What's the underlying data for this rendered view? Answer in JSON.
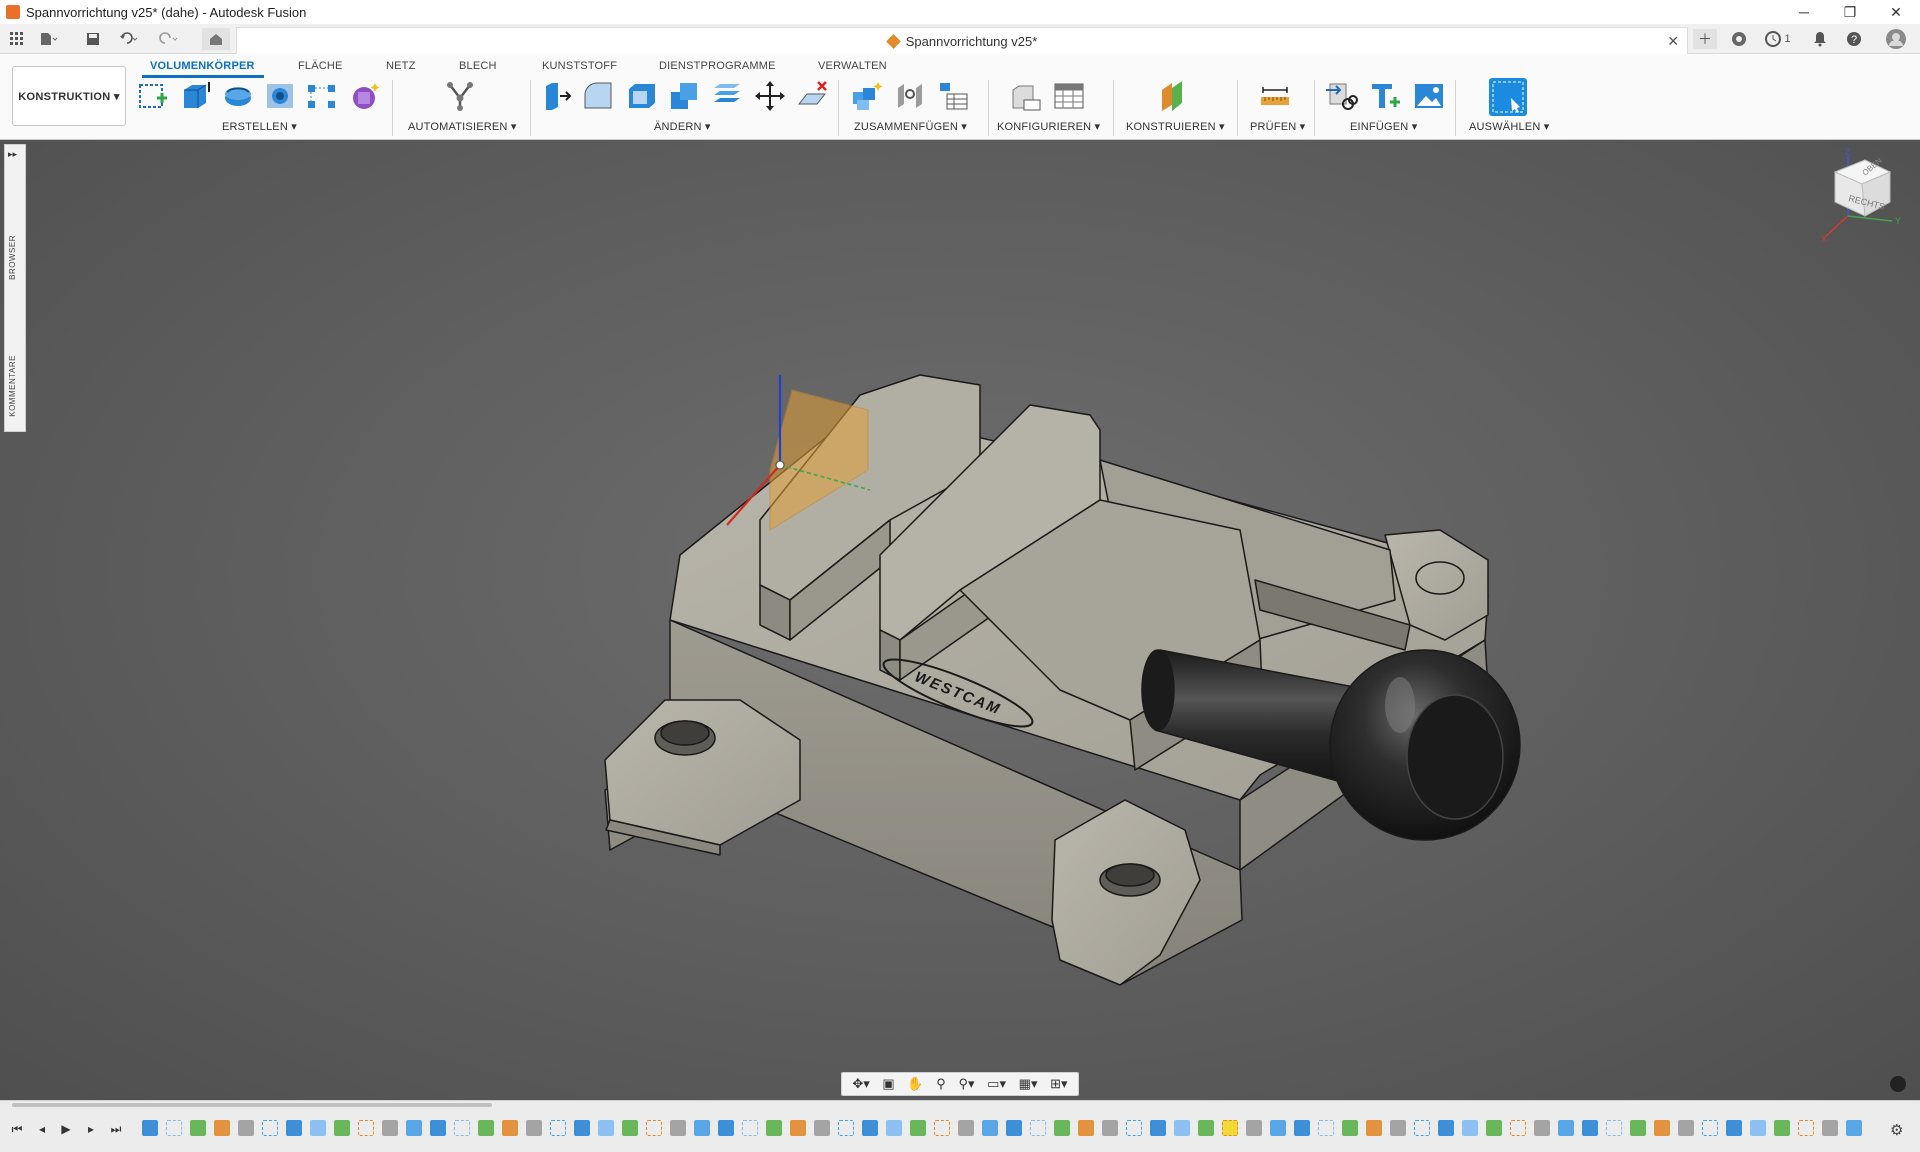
{
  "window": {
    "title": "Spannvorrichtung v25* (dahe) - Autodesk Fusion",
    "minimize": "─",
    "restore": "❐",
    "close": "✕"
  },
  "document_tab": {
    "title": "Spannvorrichtung v25*",
    "close": "✕",
    "job_count": "1"
  },
  "workspace": {
    "label": "KONSTRUKTION ▾"
  },
  "tabs": [
    {
      "label": "VOLUMENKÖRPER",
      "active": true
    },
    {
      "label": "FLÄCHE"
    },
    {
      "label": "NETZ"
    },
    {
      "label": "BLECH"
    },
    {
      "label": "KUNSTSTOFF"
    },
    {
      "label": "DIENSTPROGRAMME"
    },
    {
      "label": "VERWALTEN"
    }
  ],
  "groups": [
    {
      "label": "ERSTELLEN ▾"
    },
    {
      "label": "AUTOMATISIEREN ▾"
    },
    {
      "label": "ÄNDERN ▾"
    },
    {
      "label": "ZUSAMMENFÜGEN ▾"
    },
    {
      "label": "KONFIGURIEREN ▾"
    },
    {
      "label": "KONSTRUIEREN ▾"
    },
    {
      "label": "PRÜFEN ▾"
    },
    {
      "label": "EINFÜGEN ▾"
    },
    {
      "label": "AUSWÄHLEN ▾"
    }
  ],
  "side_panel": {
    "collapse": "▸▸",
    "browser": "BROWSER",
    "comments": "KOMMENTARE"
  },
  "viewcube": {
    "face_front": "RECHTS",
    "face_top": "OBEN",
    "axis_z": "Z",
    "axis_x": "X",
    "axis_y": "Y"
  },
  "model": {
    "engraving": "WESTCAM"
  },
  "colors": {
    "accent": "#0b6fc4",
    "part_body": "#a9a69b",
    "knob": "#2b2b2b",
    "plane": "#e2a139",
    "timeline_marker": "#f1d93a"
  },
  "timeline": {
    "controls": [
      "⏮",
      "◂",
      "▶",
      "▸",
      "⏭"
    ],
    "item_count_visible": 72
  }
}
